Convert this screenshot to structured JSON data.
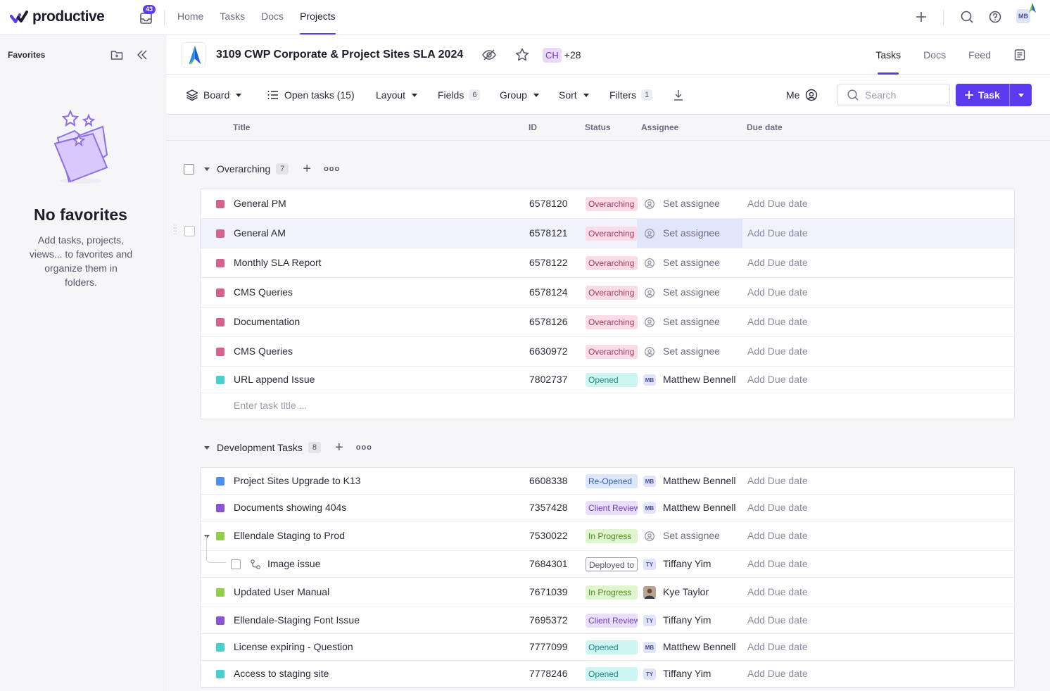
{
  "app": {
    "name": "productive",
    "inbox_count": "43"
  },
  "nav": [
    {
      "label": "Home",
      "active": false
    },
    {
      "label": "Tasks",
      "active": false
    },
    {
      "label": "Docs",
      "active": false
    },
    {
      "label": "Projects",
      "active": true
    }
  ],
  "user": {
    "initials": "MB"
  },
  "sidebar": {
    "title": "Favorites",
    "empty_title": "No favorites",
    "empty_desc": "Add tasks, projects, views... to favorites and organize them in folders."
  },
  "project": {
    "title": "3109 CWP Corporate & Project Sites SLA 2024",
    "member_chip": "CH",
    "member_more": "+28",
    "tabs": [
      {
        "label": "Tasks",
        "active": true
      },
      {
        "label": "Docs",
        "active": false
      },
      {
        "label": "Feed",
        "active": false
      }
    ]
  },
  "toolbar": {
    "board": "Board",
    "open_tasks": "Open tasks (15)",
    "layout": "Layout",
    "fields": "Fields",
    "fields_count": "6",
    "group": "Group",
    "sort": "Sort",
    "filters": "Filters",
    "filters_count": "1",
    "me": "Me",
    "search_placeholder": "Search",
    "task_button": "Task"
  },
  "columns": {
    "title": "Title",
    "id": "ID",
    "status": "Status",
    "assignee": "Assignee",
    "due": "Due date"
  },
  "groups": [
    {
      "name": "Overarching",
      "count": "7",
      "enter_placeholder": "Enter task title ...",
      "tasks": [
        {
          "title": "General PM",
          "id": "6578120",
          "status": "Overarching",
          "assignee": "Set assignee",
          "due": "Add Due date"
        },
        {
          "title": "General AM",
          "id": "6578121",
          "status": "Overarching",
          "assignee": "Set assignee",
          "due": "Add Due date"
        },
        {
          "title": "Monthly SLA Report",
          "id": "6578122",
          "status": "Overarching",
          "assignee": "Set assignee",
          "due": "Add Due date"
        },
        {
          "title": "CMS Queries",
          "id": "6578124",
          "status": "Overarching",
          "assignee": "Set assignee",
          "due": "Add Due date"
        },
        {
          "title": "Documentation",
          "id": "6578126",
          "status": "Overarching",
          "assignee": "Set assignee",
          "due": "Add Due date"
        },
        {
          "title": "CMS Queries",
          "id": "6630972",
          "status": "Overarching",
          "assignee": "Set assignee",
          "due": "Add Due date"
        },
        {
          "title": "URL append Issue",
          "id": "7802737",
          "status": "Opened",
          "assignee": "Matthew Bennell",
          "assignee_initials": "MB",
          "due": "Add Due date"
        }
      ]
    },
    {
      "name": "Development Tasks",
      "count": "8",
      "tasks": [
        {
          "title": "Project Sites Upgrade to K13",
          "id": "6608338",
          "status": "Re-Opened",
          "assignee": "Matthew Bennell",
          "assignee_initials": "MB",
          "due": "Add Due date"
        },
        {
          "title": "Documents showing 404s",
          "id": "7357428",
          "status": "Client Review",
          "assignee": "Matthew Bennell",
          "assignee_initials": "MB",
          "due": "Add Due date"
        },
        {
          "title": "Ellendale Staging to Prod",
          "id": "7530022",
          "status": "In Progress",
          "assignee": "Set assignee",
          "due": "Add Due date"
        },
        {
          "title": "Image issue",
          "id": "7684301",
          "status": "Deployed to",
          "assignee": "Tiffany Yim",
          "assignee_initials": "TY",
          "due": "Add Due date"
        },
        {
          "title": "Updated User Manual",
          "id": "7671039",
          "status": "In Progress",
          "assignee": "Kye Taylor",
          "due": "Add Due date"
        },
        {
          "title": "Ellendale-Staging Font Issue",
          "id": "7695372",
          "status": "Client Review",
          "assignee": "Tiffany Yim",
          "assignee_initials": "TY",
          "due": "Add Due date"
        },
        {
          "title": "License expiring - Question",
          "id": "7777099",
          "status": "Opened",
          "assignee": "Matthew Bennell",
          "assignee_initials": "MB",
          "due": "Add Due date"
        },
        {
          "title": "Access to staging site",
          "id": "7778246",
          "status": "Opened",
          "assignee": "Tiffany Yim",
          "assignee_initials": "TY",
          "due": "Add Due date"
        }
      ]
    }
  ],
  "colors": {
    "accent": "#5b3bf0",
    "overarching": "#d6628e",
    "opened": "#48d1cc",
    "blue": "#4c8ff0",
    "purple": "#8a52d8",
    "green": "#8fcf4a"
  }
}
